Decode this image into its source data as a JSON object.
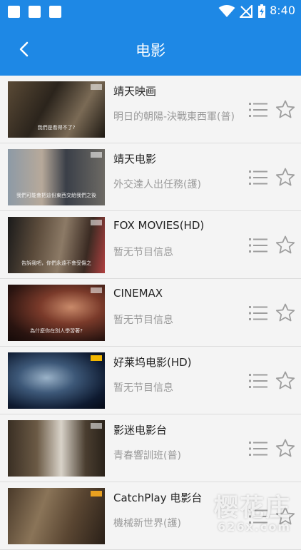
{
  "status_bar": {
    "time": "8:40"
  },
  "app_bar": {
    "title": "电影"
  },
  "channels": [
    {
      "name": "靖天映画",
      "program": "明日的朝陽-決戰東西軍(普)",
      "subtitle": "我們是看得不了?"
    },
    {
      "name": "靖天电影",
      "program": "外交達人出任務(護)",
      "subtitle": "我們可能會把這份東西交給我們之後"
    },
    {
      "name": "FOX MOVIES(HD)",
      "program": "暂无节目信息",
      "subtitle": "告訴我吧，你們永遠不會受傷之"
    },
    {
      "name": "CINEMAX",
      "program": "暂无节目信息",
      "subtitle": "為什麼你在別人學習著?"
    },
    {
      "name": "好莱坞电影(HD)",
      "program": "暂无节目信息",
      "subtitle": ""
    },
    {
      "name": "影迷电影台",
      "program": "青春響訓班(普)",
      "subtitle": ""
    },
    {
      "name": "CatchPlay 电影台",
      "program": "機械新世界(護)",
      "subtitle": ""
    }
  ],
  "watermark": {
    "line1": "樱花庄",
    "line2": "626x.com"
  },
  "colors": {
    "accent": "#1e88e5",
    "icon_gray": "#9e9e9e"
  },
  "icons": {
    "back": "chevron-left-icon",
    "list": "list-icon",
    "favorite": "star-icon"
  }
}
